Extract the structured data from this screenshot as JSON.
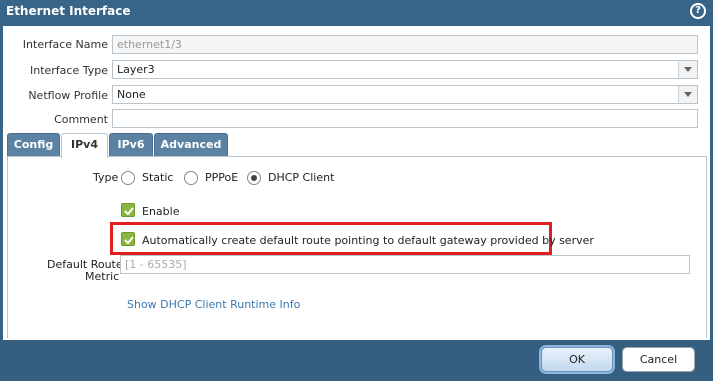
{
  "dialog": {
    "title": "Ethernet Interface",
    "help_icon": "question-mark-icon"
  },
  "fields": {
    "interface_name_label": "Interface Name",
    "interface_name_value": "ethernet1/3",
    "interface_type_label": "Interface Type",
    "interface_type_value": "Layer3",
    "netflow_profile_label": "Netflow Profile",
    "netflow_profile_value": "None",
    "comment_label": "Comment",
    "comment_value": ""
  },
  "tabs": [
    {
      "label": "Config",
      "active": false
    },
    {
      "label": "IPv4",
      "active": true
    },
    {
      "label": "IPv6",
      "active": false
    },
    {
      "label": "Advanced",
      "active": false
    }
  ],
  "ipv4": {
    "type_label": "Type",
    "type_options": [
      {
        "label": "Static",
        "checked": false
      },
      {
        "label": "PPPoE",
        "checked": false
      },
      {
        "label": "DHCP Client",
        "checked": true
      }
    ],
    "enable_label": "Enable",
    "enable_checked": true,
    "auto_route_label": "Automatically create default route pointing to default gateway provided by server",
    "auto_route_checked": true,
    "metric_label_line1": "Default Route",
    "metric_label_line2": "Metric",
    "metric_placeholder": "[1 - 65535]",
    "runtime_link": "Show DHCP Client Runtime Info"
  },
  "footer": {
    "ok_label": "OK",
    "cancel_label": "Cancel"
  },
  "colors": {
    "title_bar": "#386487",
    "checkbox_green": "#8ab53e",
    "highlight_red": "#e02020",
    "link_blue": "#3a78b0"
  }
}
